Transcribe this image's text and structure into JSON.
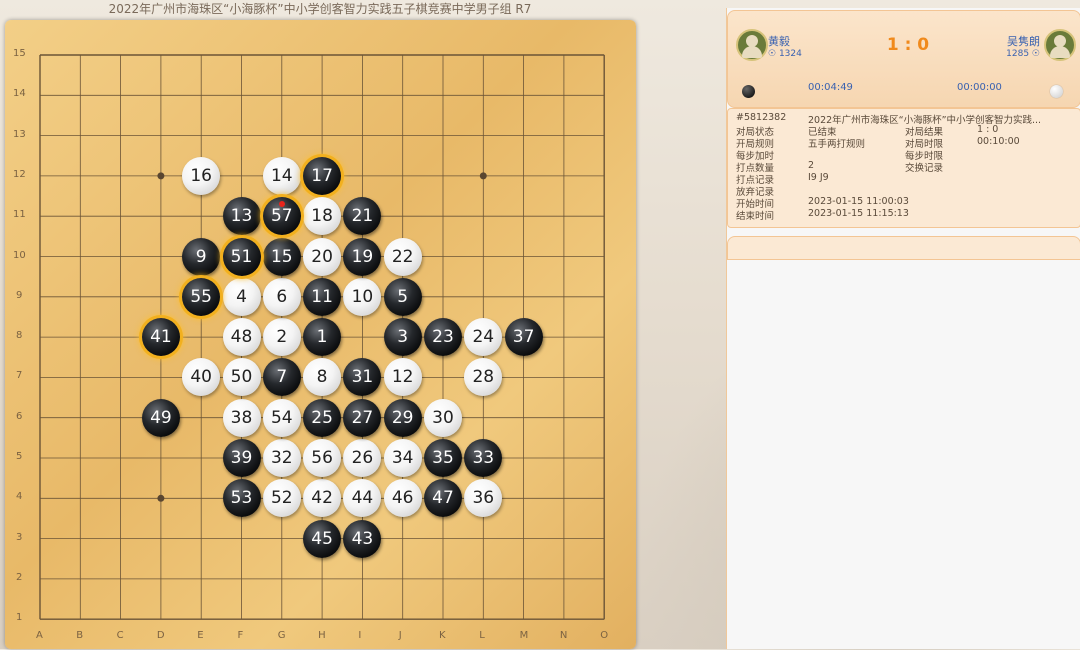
{
  "title": "2022年广州市海珠区“小海豚杯”中小学创客智力实践五子棋竞赛中学男子组 R7",
  "board": {
    "cols": [
      "A",
      "B",
      "C",
      "D",
      "E",
      "F",
      "G",
      "H",
      "I",
      "J",
      "K",
      "L",
      "M",
      "N",
      "O"
    ],
    "rows": [
      15,
      14,
      13,
      12,
      11,
      10,
      9,
      8,
      7,
      6,
      5,
      4,
      3,
      2,
      1
    ],
    "star_points": [
      "D12",
      "L12",
      "D4"
    ],
    "moves": [
      {
        "n": "1",
        "color": "black",
        "pos": "H8"
      },
      {
        "n": "2",
        "color": "white",
        "pos": "G8"
      },
      {
        "n": "3",
        "color": "black",
        "pos": "J8"
      },
      {
        "n": "4",
        "color": "white",
        "pos": "F9"
      },
      {
        "n": "5",
        "color": "black",
        "pos": "J9"
      },
      {
        "n": "6",
        "color": "white",
        "pos": "G9"
      },
      {
        "n": "7",
        "color": "black",
        "pos": "G7"
      },
      {
        "n": "8",
        "color": "white",
        "pos": "H7"
      },
      {
        "n": "9",
        "color": "black",
        "pos": "E10"
      },
      {
        "n": "10",
        "color": "white",
        "pos": "I9"
      },
      {
        "n": "11",
        "color": "black",
        "pos": "H9"
      },
      {
        "n": "12",
        "color": "white",
        "pos": "J7"
      },
      {
        "n": "13",
        "color": "black",
        "pos": "F11"
      },
      {
        "n": "14",
        "color": "white",
        "pos": "G12"
      },
      {
        "n": "15",
        "color": "black",
        "pos": "G10"
      },
      {
        "n": "16",
        "color": "white",
        "pos": "E12"
      },
      {
        "n": "17",
        "color": "black",
        "pos": "H12",
        "hl": true
      },
      {
        "n": "18",
        "color": "white",
        "pos": "H11"
      },
      {
        "n": "19",
        "color": "black",
        "pos": "I10"
      },
      {
        "n": "20",
        "color": "white",
        "pos": "H10"
      },
      {
        "n": "21",
        "color": "black",
        "pos": "I11"
      },
      {
        "n": "22",
        "color": "white",
        "pos": "J10"
      },
      {
        "n": "23",
        "color": "black",
        "pos": "K8"
      },
      {
        "n": "24",
        "color": "white",
        "pos": "L8"
      },
      {
        "n": "25",
        "color": "black",
        "pos": "H6"
      },
      {
        "n": "26",
        "color": "white",
        "pos": "I5"
      },
      {
        "n": "27",
        "color": "black",
        "pos": "I6"
      },
      {
        "n": "28",
        "color": "white",
        "pos": "L7"
      },
      {
        "n": "29",
        "color": "black",
        "pos": "J6"
      },
      {
        "n": "30",
        "color": "white",
        "pos": "K6"
      },
      {
        "n": "31",
        "color": "black",
        "pos": "I7"
      },
      {
        "n": "32",
        "color": "white",
        "pos": "G5"
      },
      {
        "n": "33",
        "color": "black",
        "pos": "L5"
      },
      {
        "n": "34",
        "color": "white",
        "pos": "J5"
      },
      {
        "n": "35",
        "color": "black",
        "pos": "K5"
      },
      {
        "n": "36",
        "color": "white",
        "pos": "L4"
      },
      {
        "n": "37",
        "color": "black",
        "pos": "M8"
      },
      {
        "n": "38",
        "color": "white",
        "pos": "F6"
      },
      {
        "n": "39",
        "color": "black",
        "pos": "F5"
      },
      {
        "n": "40",
        "color": "white",
        "pos": "E7"
      },
      {
        "n": "41",
        "color": "black",
        "pos": "D8",
        "hl": true
      },
      {
        "n": "42",
        "color": "white",
        "pos": "H4"
      },
      {
        "n": "43",
        "color": "black",
        "pos": "I3"
      },
      {
        "n": "44",
        "color": "white",
        "pos": "I4"
      },
      {
        "n": "45",
        "color": "black",
        "pos": "H3"
      },
      {
        "n": "46",
        "color": "white",
        "pos": "J4"
      },
      {
        "n": "47",
        "color": "black",
        "pos": "K4"
      },
      {
        "n": "48",
        "color": "white",
        "pos": "F8"
      },
      {
        "n": "49",
        "color": "black",
        "pos": "D6"
      },
      {
        "n": "50",
        "color": "white",
        "pos": "F7"
      },
      {
        "n": "51",
        "color": "black",
        "pos": "F10",
        "hl": true
      },
      {
        "n": "52",
        "color": "white",
        "pos": "G4"
      },
      {
        "n": "53",
        "color": "black",
        "pos": "F4"
      },
      {
        "n": "54",
        "color": "white",
        "pos": "G6"
      },
      {
        "n": "55",
        "color": "black",
        "pos": "E9",
        "hl": true
      },
      {
        "n": "56",
        "color": "white",
        "pos": "H5"
      },
      {
        "n": "57",
        "color": "black",
        "pos": "G11",
        "hl": true,
        "last": true
      }
    ]
  },
  "players": {
    "black": {
      "name": "黄毅",
      "rating": "1324",
      "time": "00:04:49"
    },
    "white": {
      "name": "吴隽朗",
      "rating": "1285",
      "time": "00:00:00"
    },
    "score": "1 : 0"
  },
  "info": {
    "id": "#5812382",
    "match_name": "2022年广州市海珠区“小海豚杯”中小学创客智力实践...",
    "status_label": "对局状态",
    "status_value": "已结束",
    "result_label": "对局结果",
    "result_value": "1 : 0",
    "opening_label": "开局规则",
    "opening_value": "五手两打规则",
    "limit_label": "对局时限",
    "limit_value": "00:10:00",
    "inc_label": "每步加时",
    "step_limit_label": "每步时限",
    "count_label": "打点数量",
    "count_value": "2",
    "swap_label": "交换记录",
    "record_label": "打点记录",
    "record_value": "I9 J9",
    "resign_label": "放弃记录",
    "start_label": "开始时间",
    "start_value": "2023-01-15 11:00:03",
    "end_label": "结束时间",
    "end_value": "2023-01-15 11:15:13"
  },
  "colors": {
    "accent": "#f08a1c",
    "link": "#3a62b0",
    "highlight": "#f2b01e",
    "last_move": "#e8241c"
  }
}
